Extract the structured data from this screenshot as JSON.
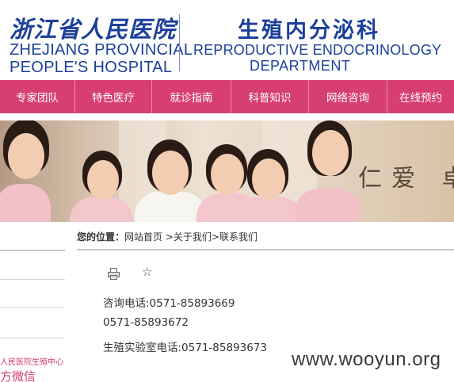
{
  "header": {
    "hospital_cn": "浙江省人民医院",
    "hospital_en_line1": "ZHEJIANG PROVINCIAL",
    "hospital_en_line2": "PEOPLE'S HOSPITAL",
    "dept_cn": "生殖内分泌科",
    "dept_en_line1": "REPRODUCTIVE ENDOCRINOLOGY",
    "dept_en_line2": "DEPARTMENT"
  },
  "nav": {
    "items": [
      {
        "label": "专家团队"
      },
      {
        "label": "特色医疗"
      },
      {
        "label": "就诊指南"
      },
      {
        "label": "科普知识"
      },
      {
        "label": "网络咨询"
      },
      {
        "label": "在线预约"
      }
    ]
  },
  "banner": {
    "slogan": "仁爱 卓"
  },
  "sidebar": {
    "sub_text": "人民医院生殖中心",
    "wechat_text": "方微信"
  },
  "breadcrumb": {
    "prefix": "您的位置：",
    "path": "网站首页 >关于我们>联系我们"
  },
  "content": {
    "line1": "咨询电话:0571-85893669",
    "line2": "0571-85893672",
    "line3": "生殖实验室电话:0571-85893673"
  },
  "watermark": "www.wooyun.org",
  "colors": {
    "nav_bg": "#d73e74",
    "brand_blue": "#1b3f9a"
  },
  "icons": {
    "print": "print-icon",
    "favorite": "star-icon"
  }
}
